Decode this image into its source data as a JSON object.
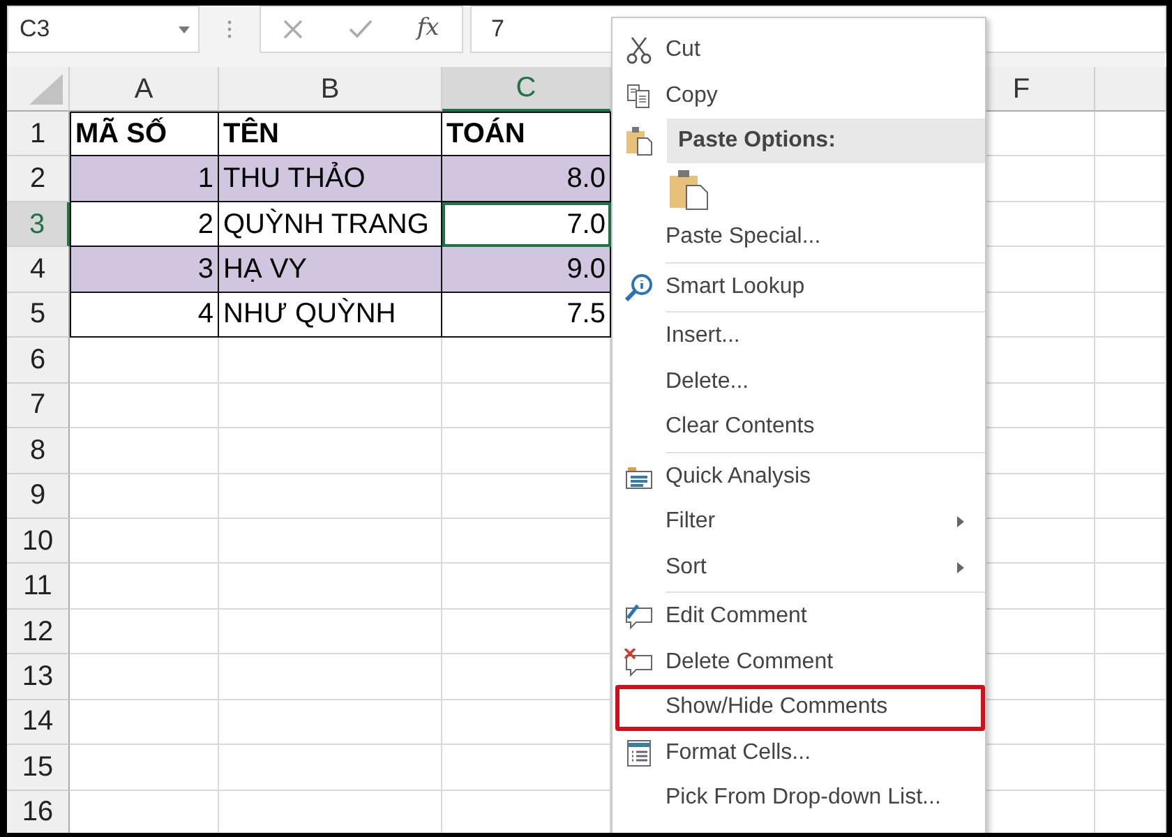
{
  "formula_bar": {
    "name_box": "C3",
    "function_label": "fx",
    "formula": "7"
  },
  "columns": [
    {
      "label": "A",
      "selected": false
    },
    {
      "label": "B",
      "selected": false
    },
    {
      "label": "C",
      "selected": true
    },
    {
      "label": "F",
      "selected": false
    },
    {
      "selected": false
    }
  ],
  "rows": [
    {
      "header": "1",
      "kind": "header",
      "selected": false,
      "highlighted": false,
      "cells": [
        "MÃ SỐ",
        "TÊN",
        "TOÁN"
      ]
    },
    {
      "header": "2",
      "kind": "data",
      "selected": false,
      "highlighted": true,
      "cells": [
        "1",
        "THU THẢO",
        "8.0"
      ]
    },
    {
      "header": "3",
      "kind": "data",
      "selected": true,
      "highlighted": false,
      "cells": [
        "2",
        "QUỲNH TRANG",
        "7.0"
      ]
    },
    {
      "header": "4",
      "kind": "data",
      "selected": false,
      "highlighted": true,
      "cells": [
        "3",
        "HẠ VY",
        "9.0"
      ]
    },
    {
      "header": "5",
      "kind": "data",
      "selected": false,
      "highlighted": false,
      "cells": [
        "4",
        "NHƯ QUỲNH",
        "7.5"
      ]
    },
    {
      "header": "6",
      "kind": "empty",
      "selected": false
    },
    {
      "header": "7",
      "kind": "empty",
      "selected": false
    },
    {
      "header": "8",
      "kind": "empty",
      "selected": false
    },
    {
      "header": "9",
      "kind": "empty",
      "selected": false
    },
    {
      "header": "10",
      "kind": "empty",
      "selected": false
    },
    {
      "header": "11",
      "kind": "empty",
      "selected": false
    },
    {
      "header": "12",
      "kind": "empty",
      "selected": false
    },
    {
      "header": "13",
      "kind": "empty",
      "selected": false
    },
    {
      "header": "14",
      "kind": "empty",
      "selected": false
    },
    {
      "header": "15",
      "kind": "empty",
      "selected": false
    },
    {
      "header": "16",
      "kind": "empty",
      "selected": false
    }
  ],
  "context_menu": [
    {
      "kind": "item",
      "label": "Cut",
      "submenu": false,
      "highlighted": false
    },
    {
      "kind": "item",
      "label": "Copy",
      "submenu": false,
      "highlighted": false
    },
    {
      "kind": "header",
      "label": "Paste Options:"
    },
    {
      "kind": "paste-icons"
    },
    {
      "kind": "item",
      "label": "Paste Special...",
      "submenu": false,
      "highlighted": false
    },
    {
      "kind": "separator"
    },
    {
      "kind": "item",
      "label": "Smart Lookup",
      "submenu": false,
      "highlighted": false
    },
    {
      "kind": "separator"
    },
    {
      "kind": "item",
      "label": "Insert...",
      "submenu": false,
      "highlighted": false
    },
    {
      "kind": "item",
      "label": "Delete...",
      "submenu": false,
      "highlighted": false
    },
    {
      "kind": "item",
      "label": "Clear Contents",
      "submenu": false,
      "highlighted": false
    },
    {
      "kind": "separator"
    },
    {
      "kind": "item",
      "label": "Quick Analysis",
      "submenu": false,
      "highlighted": false
    },
    {
      "kind": "item",
      "label": "Filter",
      "submenu": true,
      "highlighted": false
    },
    {
      "kind": "item",
      "label": "Sort",
      "submenu": true,
      "highlighted": false
    },
    {
      "kind": "separator"
    },
    {
      "kind": "item",
      "label": "Edit Comment",
      "submenu": false,
      "highlighted": false
    },
    {
      "kind": "item",
      "label": "Delete Comment",
      "submenu": false,
      "highlighted": false
    },
    {
      "kind": "item",
      "label": "Show/Hide Comments",
      "submenu": false,
      "highlighted": true
    },
    {
      "kind": "item",
      "label": "Format Cells...",
      "submenu": false,
      "highlighted": false
    },
    {
      "kind": "item",
      "label": "Pick From Drop-down List...",
      "submenu": false,
      "highlighted": false
    }
  ]
}
